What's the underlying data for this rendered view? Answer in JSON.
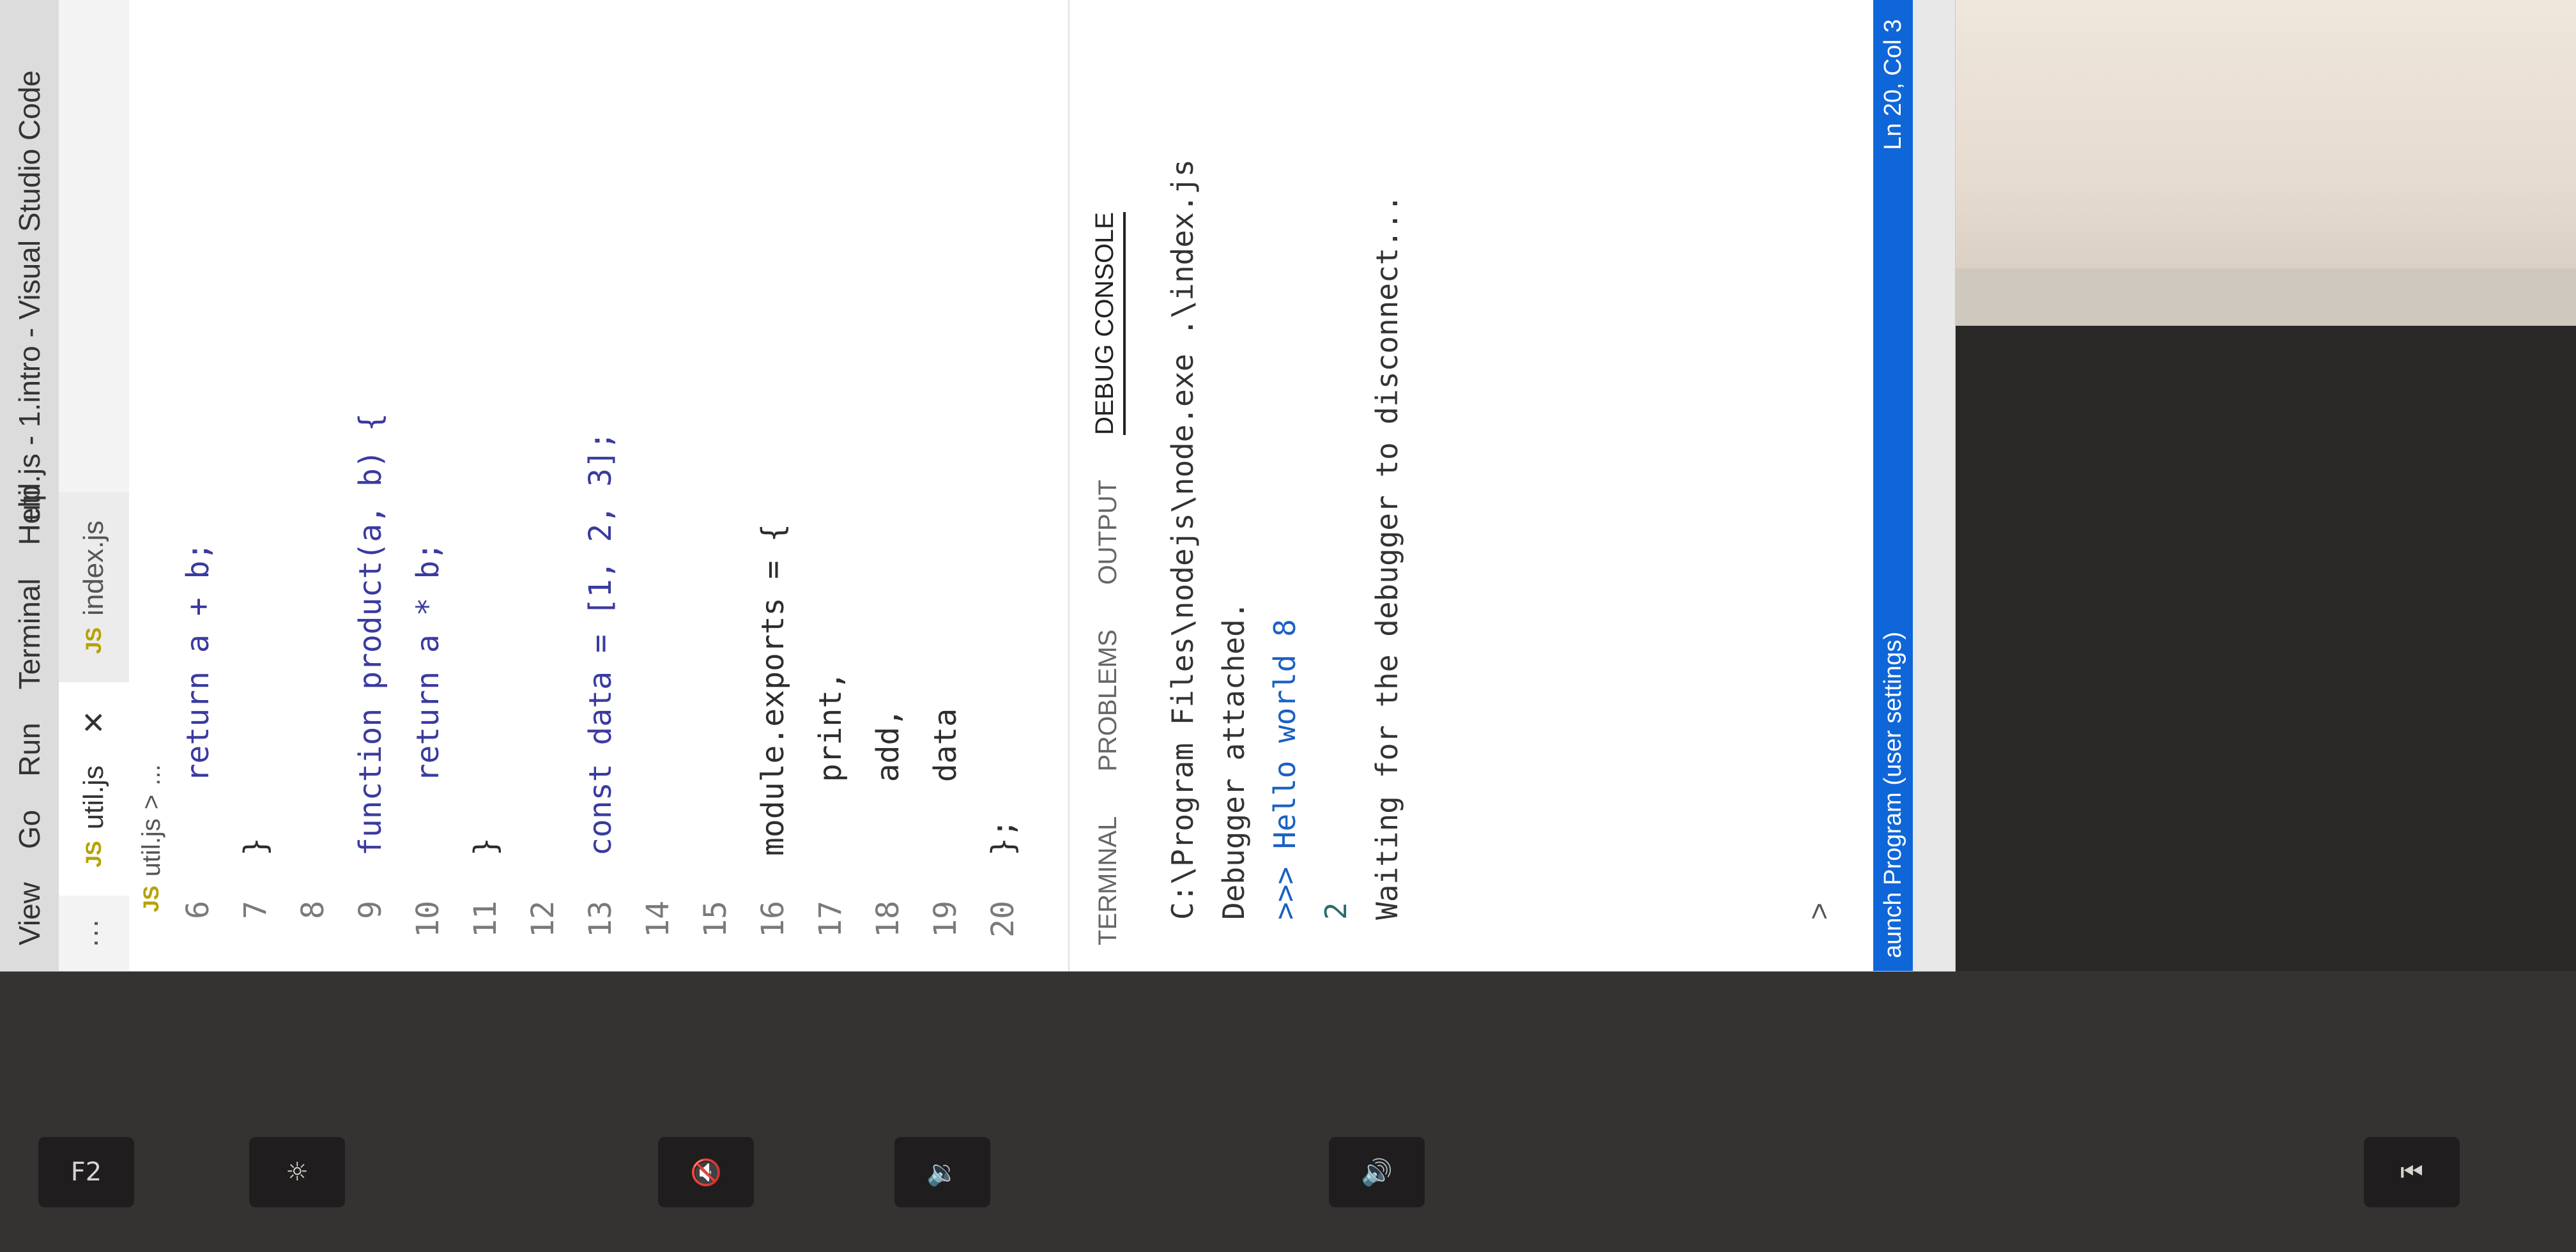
{
  "menu": [
    "View",
    "Go",
    "Run",
    "Terminal",
    "Help"
  ],
  "window_title": "util.js - 1.intro - Visual Studio Code",
  "tabs": [
    {
      "badge": "JS",
      "label": "util.js",
      "active": true
    },
    {
      "badge": "JS",
      "label": "index.js",
      "active": false
    }
  ],
  "tab_more": "···",
  "tab_close": "✕",
  "breadcrumb": {
    "badge": "JS",
    "file": "util.js",
    "separator": ">",
    "tail": "..."
  },
  "code_lines": [
    {
      "n": "6",
      "text": "    return a + b;"
    },
    {
      "n": "7",
      "text": "}"
    },
    {
      "n": "8",
      "text": ""
    },
    {
      "n": "9",
      "text": "function product(a, b) {"
    },
    {
      "n": "10",
      "text": "    return a * b;"
    },
    {
      "n": "11",
      "text": "}"
    },
    {
      "n": "12",
      "text": ""
    },
    {
      "n": "13",
      "text": "const data = [1, 2, 3];"
    },
    {
      "n": "14",
      "text": ""
    },
    {
      "n": "15",
      "text": ""
    },
    {
      "n": "16",
      "text": "module.exports = {"
    },
    {
      "n": "17",
      "text": "    print,"
    },
    {
      "n": "18",
      "text": "    add,"
    },
    {
      "n": "19",
      "text": "    data"
    },
    {
      "n": "20",
      "text": "};"
    }
  ],
  "panel_tabs": [
    "TERMINAL",
    "PROBLEMS",
    "OUTPUT",
    "DEBUG CONSOLE"
  ],
  "console": [
    {
      "text": "C:\\Program Files\\nodejs\\node.exe .\\index.js",
      "style": "dark"
    },
    {
      "text": "Debugger attached.",
      "style": "dark"
    },
    {
      "text": ">>> Hello world 8",
      "style": "blue"
    },
    {
      "text": "2",
      "style": "num"
    },
    {
      "text": "Waiting for the debugger to disconnect...",
      "style": "dark"
    }
  ],
  "console_prompt": ">",
  "status": {
    "left": "aunch Program (user settings)",
    "right": "Ln 20, Col 3"
  },
  "keyboard": {
    "f2": "F2"
  }
}
